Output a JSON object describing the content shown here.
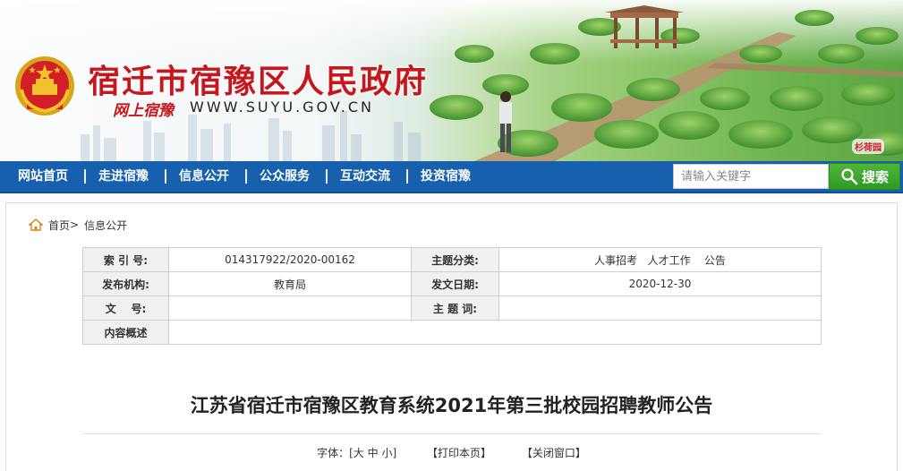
{
  "header": {
    "site_title": "宿迁市宿豫区人民政府",
    "slogan": "网上宿豫",
    "url_text": "WWW.SUYU.GOV.CN",
    "brand_tag": "杉荷园",
    "emblem_icon": "national-emblem-icon",
    "colors": {
      "title_red": "#c8161d",
      "nav_blue": "#1660ad",
      "search_green": "#3aa52b"
    }
  },
  "nav": {
    "items": [
      {
        "label": "网站首页"
      },
      {
        "label": "走进宿豫"
      },
      {
        "label": "信息公开"
      },
      {
        "label": "公众服务"
      },
      {
        "label": "互动交流"
      },
      {
        "label": "投资宿豫"
      }
    ]
  },
  "search": {
    "placeholder": "请输入关键字",
    "button_label": "搜索",
    "button_icon": "search-icon"
  },
  "breadcrumb": {
    "home_icon": "home-icon",
    "home": "首页",
    "separator": ">",
    "current": "信息公开"
  },
  "meta": {
    "rows": [
      {
        "label1": "索 引 号:",
        "value1": "014317922/2020-00162",
        "label2": "主题分类:",
        "value2": "人事招考   人才工作    公告"
      },
      {
        "label1": "发布机构:",
        "value1": "教育局",
        "label2": "发文日期:",
        "value2": "2020-12-30"
      },
      {
        "label1": "文    号:",
        "value1": "",
        "label2": "主 题 词:",
        "value2": ""
      },
      {
        "label1": "内容概述",
        "value1": ""
      }
    ]
  },
  "article": {
    "title": "江苏省宿迁市宿豫区教育系统2021年第三批校园招聘教师公告"
  },
  "tools": {
    "font_label": "字体：[",
    "font_large": "大",
    "font_medium": "中",
    "font_small": "小",
    "font_close": "]",
    "print": "【打印本页】",
    "close": "【关闭窗口】"
  }
}
